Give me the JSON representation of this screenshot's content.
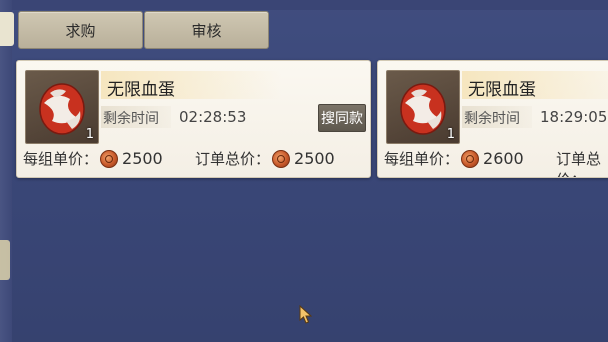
{
  "tabs": [
    {
      "label": "求购"
    },
    {
      "label": "审核"
    }
  ],
  "listings": [
    {
      "name": "无限血蛋",
      "quantity": "1",
      "time_label": "剩余时间",
      "time_remaining": "02:28:53",
      "search_same_label": "搜同款",
      "unit_price_label": "每组单价：",
      "unit_price": "2500",
      "total_price_label": "订单总价：",
      "total_price": "2500"
    },
    {
      "name": "无限血蛋",
      "quantity": "1",
      "time_label": "剩余时间",
      "time_remaining": "18:29:05",
      "unit_price_label": "每组单价：",
      "unit_price": "2600",
      "total_price_label": "订单总价："
    }
  ],
  "icons": {
    "item": "red-egg-icon",
    "currency": "coin-icon",
    "cursor": "mouse-pointer-icon"
  },
  "colors": {
    "background": "#3a4778",
    "card": "#f7f3ea",
    "tab": "#c6bea8"
  }
}
